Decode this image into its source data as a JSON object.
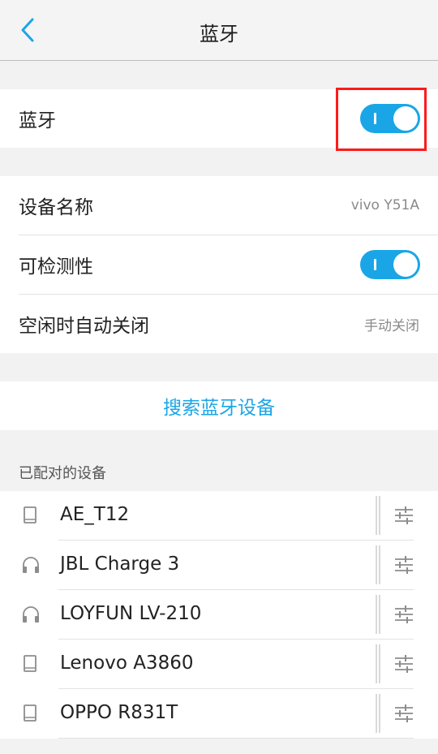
{
  "header": {
    "title": "蓝牙"
  },
  "bluetooth": {
    "label": "蓝牙",
    "enabled": true
  },
  "settings": {
    "device_name_label": "设备名称",
    "device_name_value": "vivo Y51A",
    "discoverable_label": "可检测性",
    "discoverable_enabled": true,
    "idle_off_label": "空闲时自动关闭",
    "idle_off_value": "手动关闭"
  },
  "search": {
    "label": "搜索蓝牙设备"
  },
  "paired": {
    "section_title": "已配对的设备",
    "devices": [
      {
        "name": "AE_T12",
        "icon": "phone-icon"
      },
      {
        "name": "JBL Charge 3",
        "icon": "headphones-icon"
      },
      {
        "name": "LOYFUN LV-210",
        "icon": "headphones-icon"
      },
      {
        "name": "Lenovo A3860",
        "icon": "phone-icon"
      },
      {
        "name": "OPPO R831T",
        "icon": "phone-icon"
      }
    ]
  },
  "colors": {
    "accent": "#1aa6e6",
    "highlight": "#ff1a1a"
  }
}
